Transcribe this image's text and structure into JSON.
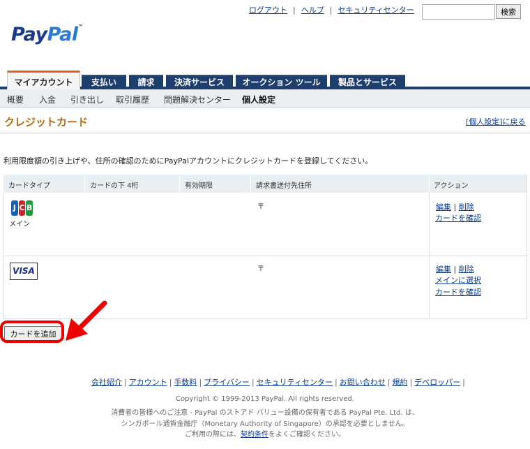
{
  "header": {
    "links": [
      "ログアウト",
      "ヘルプ",
      "セキュリティセンター"
    ],
    "separator": "|",
    "search_placeholder": "",
    "search_button": "検索",
    "logo_pay": "Pay",
    "logo_pal": "Pal",
    "logo_tm": "™"
  },
  "tabs": [
    "マイアカウント",
    "支払い",
    "請求",
    "決済サービス",
    "オークション ツール",
    "製品とサービス"
  ],
  "subnav": [
    "概要",
    "入金",
    "引き出し",
    "取引履歴",
    "問題解決センター",
    "個人設定"
  ],
  "page": {
    "title": "クレジットカード",
    "back_link": "[個人設定]に戻る",
    "intro": "利用限度額の引き上げや、住所の確認のためにPayPalアカウントにクレジットカードを登録してください。"
  },
  "table": {
    "headers": [
      "カードタイプ",
      "カードの下 4桁",
      "有効期限",
      "請求書送付先住所",
      "アクション"
    ],
    "rows": [
      {
        "card": "JCB",
        "card_glyphs": [
          "J",
          "C",
          "B"
        ],
        "primary_label": "メイン",
        "address": "〒",
        "actions": [
          "編集",
          "削除",
          "カードを確認"
        ]
      },
      {
        "card": "VISA",
        "address": "〒",
        "actions": [
          "編集",
          "削除",
          "メインに選択",
          "カードを確認"
        ]
      }
    ],
    "action_separator": "|"
  },
  "add_card_button": "カードを追加",
  "footer": {
    "links": [
      "会社紹介",
      "アカウント",
      "手数料",
      "プライバシー",
      "セキュリティセンター",
      "お問い合わせ",
      "規約",
      "デベロッパー"
    ],
    "copyright": "Copyright © 1999-2013 PayPal. All rights reserved.",
    "notice1": "消費者の皆様へのご注意 - PayPal のストアド バリュー設備の保有者である PayPal Pte. Ltd. は、",
    "notice2": "シンガポール通貨金融庁（Monetary Authority of Singapore）の承認を必要としません。",
    "notice3_pre": "ご利用の際には、",
    "notice3_link": "契約条件",
    "notice3_post": "をよくご確認ください。"
  },
  "colors": {
    "nav": "#1e3e6e",
    "title": "#b36a0f",
    "annotation": "#e00000"
  }
}
